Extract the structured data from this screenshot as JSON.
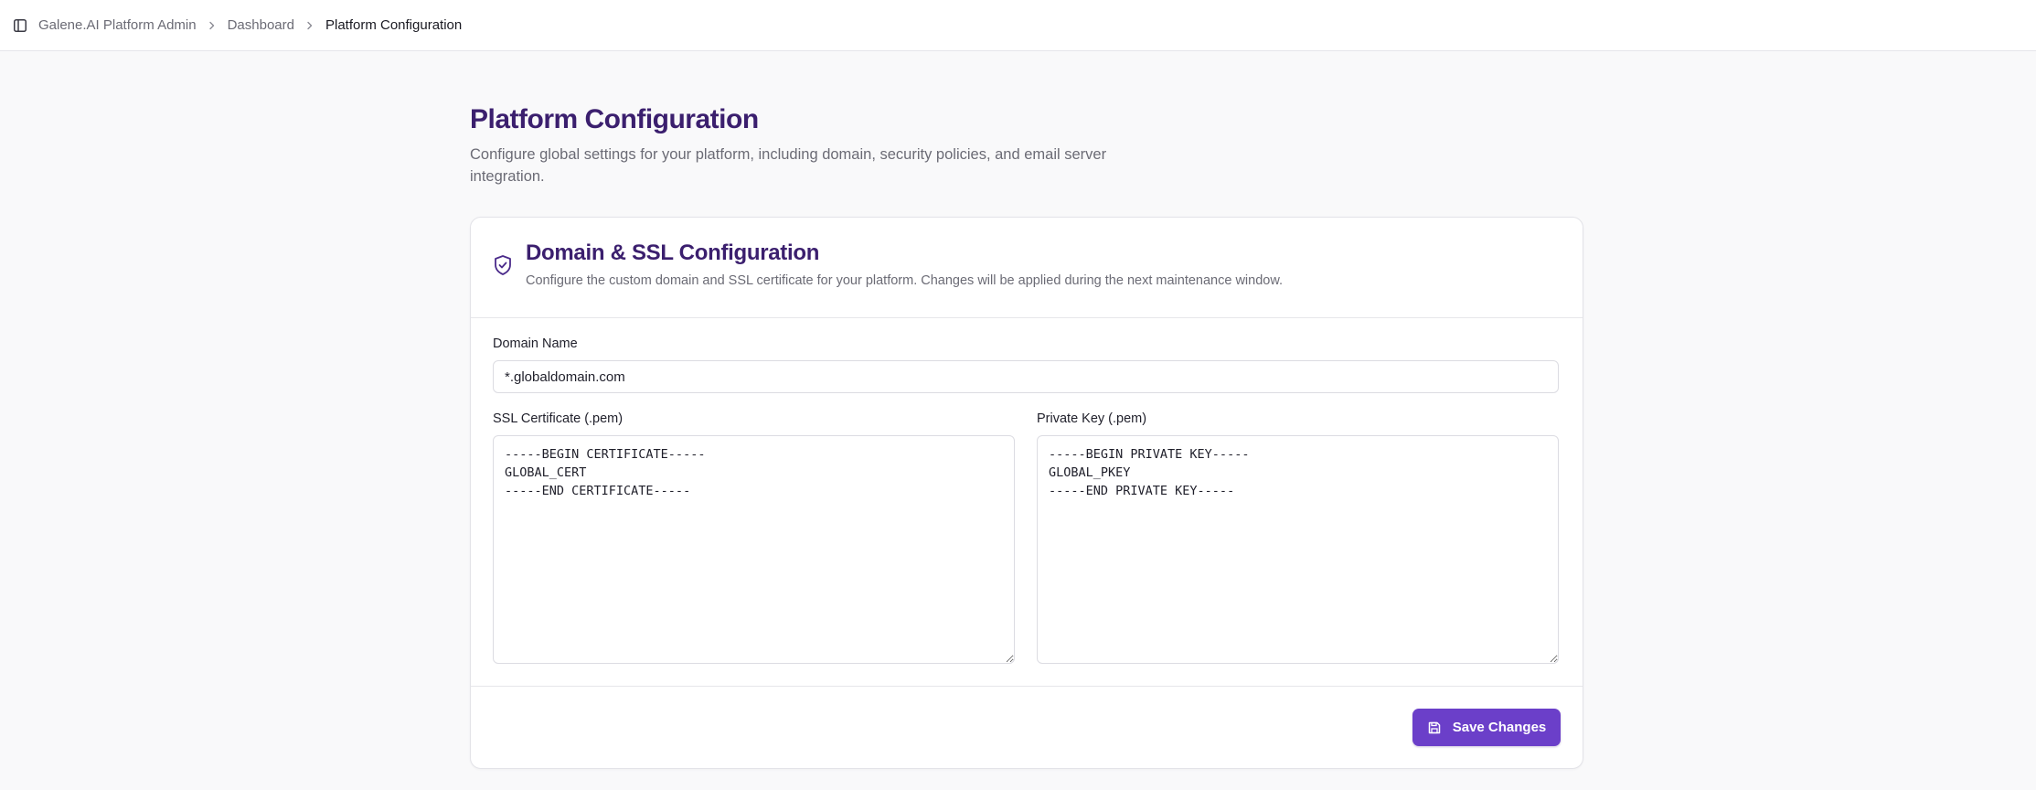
{
  "header": {
    "breadcrumb": [
      {
        "label": "Galene.AI Platform Admin"
      },
      {
        "label": "Dashboard"
      },
      {
        "label": "Platform Configuration"
      }
    ]
  },
  "page": {
    "title": "Platform Configuration",
    "description": "Configure global settings for your platform, including domain, security policies, and email server integration."
  },
  "card": {
    "icon": "shield-check-icon",
    "title": "Domain & SSL Configuration",
    "subtitle": "Configure the custom domain and SSL certificate for your platform. Changes will be applied during the next maintenance window.",
    "domain": {
      "label": "Domain Name",
      "value": "*.globaldomain.com"
    },
    "ssl_certificate": {
      "label": "SSL Certificate (.pem)",
      "value": "-----BEGIN CERTIFICATE-----\nGLOBAL_CERT\n-----END CERTIFICATE-----"
    },
    "private_key": {
      "label": "Private Key (.pem)",
      "value": "-----BEGIN PRIVATE KEY-----\nGLOBAL_PKEY\n-----END PRIVATE KEY-----"
    },
    "save_label": "Save Changes"
  },
  "colors": {
    "accent": "#6b3fc9",
    "title": "#3b1f6e",
    "muted_text": "#6b6b75",
    "background": "#f9f9fa"
  }
}
